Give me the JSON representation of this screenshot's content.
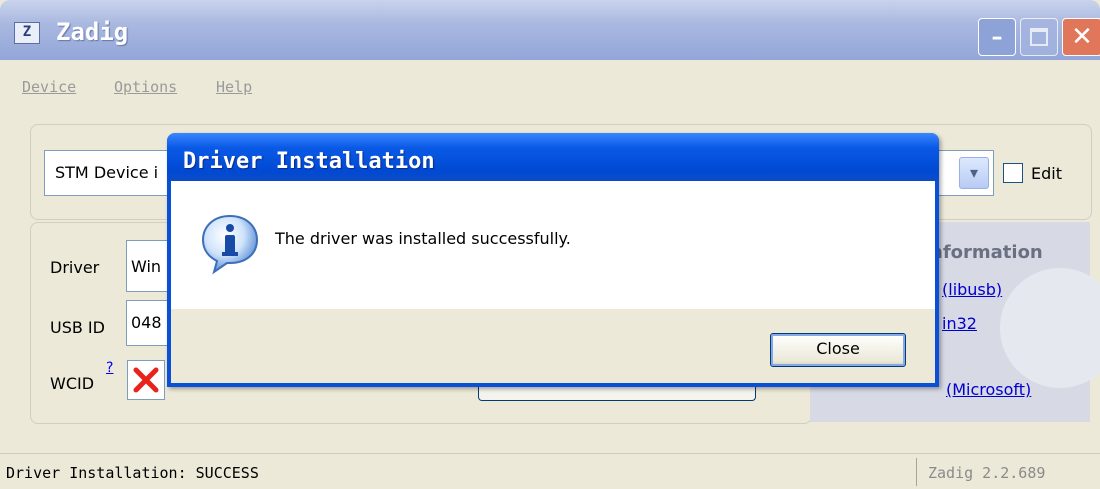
{
  "window": {
    "title": "Zadig",
    "app_icon_letter": "Z"
  },
  "menu": [
    {
      "label": "Device"
    },
    {
      "label": "Options"
    },
    {
      "label": "Help"
    }
  ],
  "device": {
    "selected": "STM Device i",
    "edit_label": "Edit"
  },
  "driver_panel": {
    "driver_label": "Driver",
    "driver_value": "Win",
    "usbid_label": "USB ID",
    "usbid_value": "048",
    "wcid_label": "WCID",
    "wcid_help": "?"
  },
  "info_panel": {
    "title": "nformation",
    "links": [
      "(libusb)",
      "in32",
      "(Microsoft)"
    ]
  },
  "status": {
    "left": "Driver Installation: SUCCESS",
    "right": "Zadig 2.2.689"
  },
  "dialog": {
    "title": "Driver Installation",
    "message": "The driver was installed successfully.",
    "close_label": "Close"
  },
  "colors": {
    "dialog_blue": "#0a4fd8",
    "link": "#0000cc",
    "error_red": "#e8231b"
  }
}
